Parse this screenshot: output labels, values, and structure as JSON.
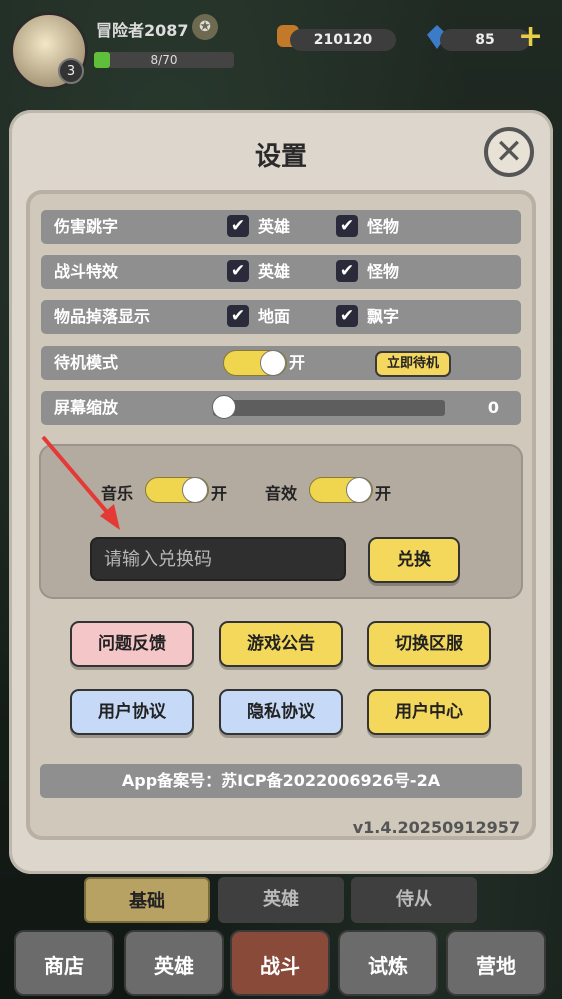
{
  "hud": {
    "player_name": "冒险者2087",
    "level": "3",
    "exp_text": "8/70",
    "exp_fraction": 0.114,
    "gold": "210120",
    "gems": "85",
    "plus_label": "+"
  },
  "settings": {
    "title": "设置",
    "close_icon": "close-icon",
    "rows": {
      "damage_numbers": {
        "label": "伤害跳字",
        "opt1": "英雄",
        "opt1_checked": true,
        "opt2": "怪物",
        "opt2_checked": true
      },
      "combat_effects": {
        "label": "战斗特效",
        "opt1": "英雄",
        "opt1_checked": true,
        "opt2": "怪物",
        "opt2_checked": true
      },
      "item_drop": {
        "label": "物品掉落显示",
        "opt1": "地面",
        "opt1_checked": true,
        "opt2": "飘字",
        "opt2_checked": true
      },
      "standby": {
        "label": "待机模式",
        "toggle_state": "开",
        "button": "立即待机"
      },
      "zoom": {
        "label": "屏幕缩放",
        "value": "0"
      }
    },
    "audio": {
      "music_label": "音乐",
      "music_state": "开",
      "sfx_label": "音效",
      "sfx_state": "开"
    },
    "redeem": {
      "placeholder": "请输入兑换码",
      "button": "兑换"
    },
    "buttons": {
      "feedback": "问题反馈",
      "announcement": "游戏公告",
      "switch_server": "切换区服",
      "user_agreement": "用户协议",
      "privacy": "隐私协议",
      "user_center": "用户中心"
    },
    "record_number": "App备案号：苏ICP备2022006926号-2A",
    "version": "v1.4.20250912957"
  },
  "tabs": {
    "basic": "基础",
    "hero": "英雄",
    "attendant": "侍从"
  },
  "nav": {
    "shop": "商店",
    "hero": "英雄",
    "battle": "战斗",
    "trial": "试炼",
    "camp": "营地"
  },
  "colors": {
    "accent_yellow": "#f4d85c",
    "row_gray": "#8f8f8f",
    "panel_bg": "#dcd6cc",
    "annotation_arrow": "#e53935"
  }
}
